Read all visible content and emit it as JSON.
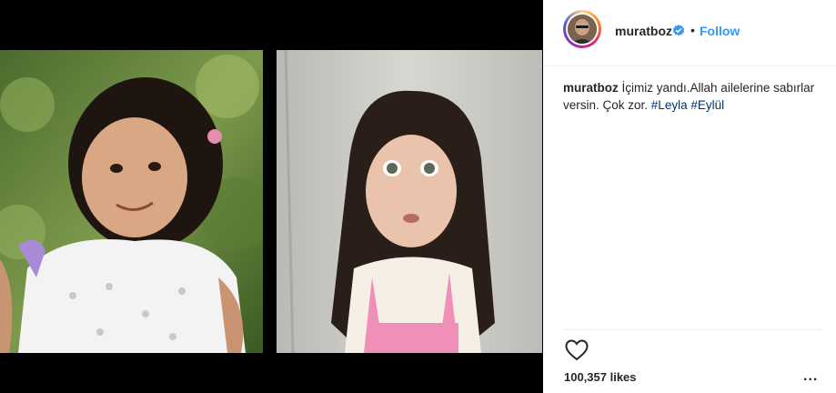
{
  "post": {
    "username": "muratboz",
    "follow_label": "Follow",
    "dot": "•",
    "caption": {
      "username": "muratboz",
      "text": "İçimiz yandı.Allah ailelerine sabırlar versin. Çok zor.",
      "hashtags": [
        "#Leyla",
        "#Eylül"
      ]
    },
    "likes": "100,357 likes",
    "more": "..."
  },
  "icons": {
    "verified": "verified-badge-icon",
    "heart": "heart-icon",
    "more": "more-options-icon"
  },
  "colors": {
    "link": "#3897f0",
    "hashtag": "#003569",
    "text": "#262626",
    "media_background": "#000000"
  }
}
